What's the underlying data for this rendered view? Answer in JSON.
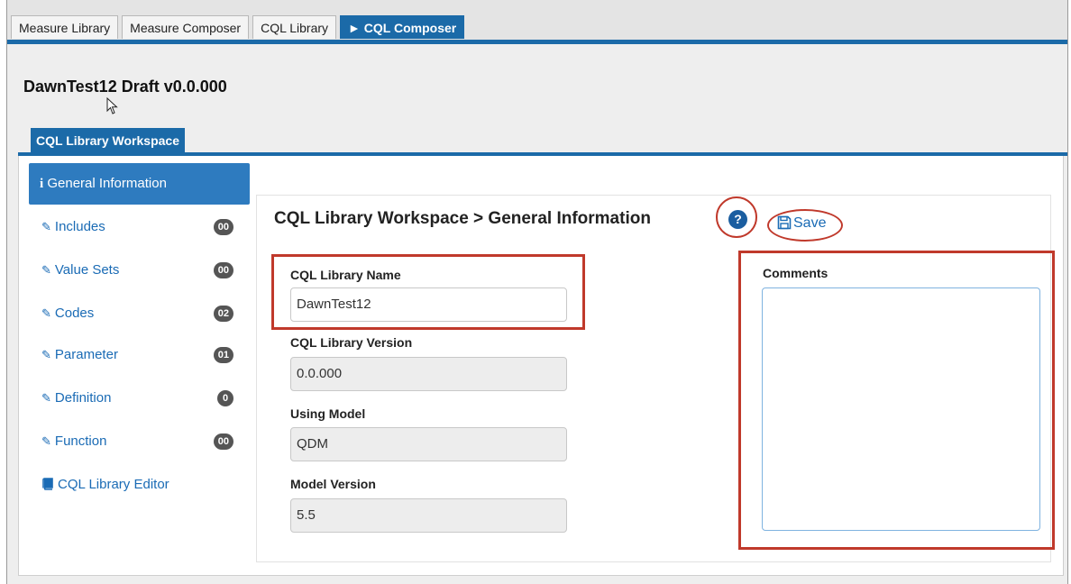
{
  "top_tabs": {
    "measure_library": "Measure Library",
    "measure_composer": "Measure Composer",
    "cql_library": "CQL Library",
    "cql_composer": "► CQL Composer"
  },
  "draft_title": "DawnTest12 Draft v0.0.000",
  "workspace_tab": "CQL Library Workspace",
  "sidebar": {
    "general_info": "General Information",
    "items": [
      {
        "label": "Includes",
        "badge": "00"
      },
      {
        "label": "Value Sets",
        "badge": "00"
      },
      {
        "label": "Codes",
        "badge": "02"
      },
      {
        "label": "Parameter",
        "badge": "01"
      },
      {
        "label": "Definition",
        "badge": "0"
      },
      {
        "label": "Function",
        "badge": "00"
      }
    ],
    "editor": "CQL Library Editor"
  },
  "main": {
    "heading": "CQL Library Workspace > General Information",
    "help_glyph": "?",
    "save_label": "Save",
    "name_label": "CQL Library Name",
    "name_value": "DawnTest12",
    "version_label": "CQL Library Version",
    "version_value": "0.0.000",
    "model_label": "Using Model",
    "model_value": "QDM",
    "model_version_label": "Model Version",
    "model_version_value": "5.5",
    "comments_label": "Comments",
    "comments_value": ""
  },
  "colors": {
    "accent_blue": "#1b6aa8",
    "annotation_red": "#c0392b",
    "badge_gray": "#555555"
  }
}
